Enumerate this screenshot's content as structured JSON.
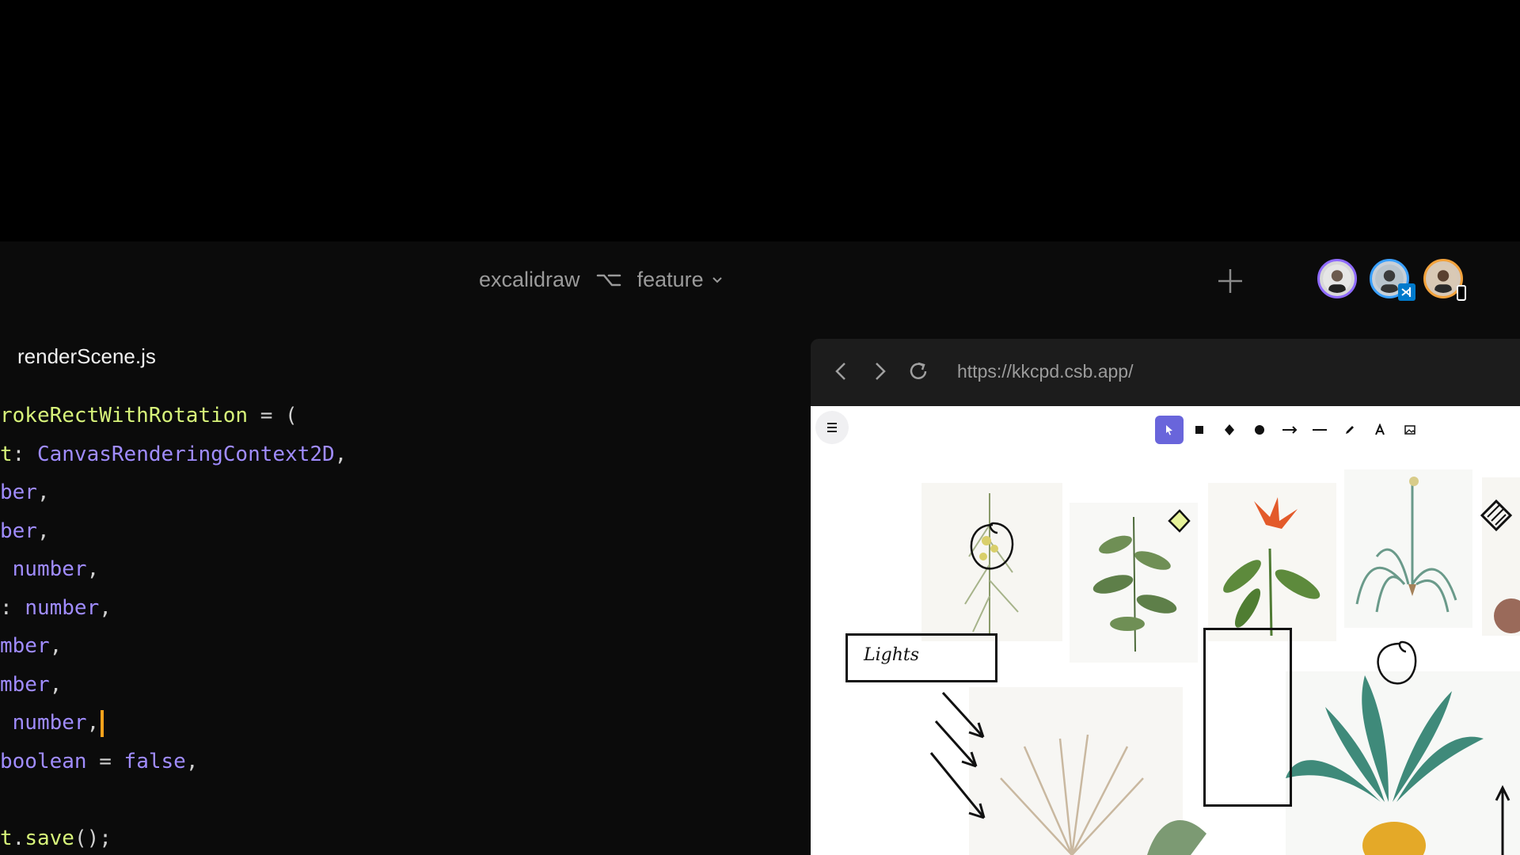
{
  "header": {
    "repo_name": "excalidraw",
    "branch_name": "feature"
  },
  "editor": {
    "file_tab": "renderScene.js",
    "lines": [
      [
        {
          "c": "fn",
          "t": "rokeRectWithRotation"
        },
        {
          "c": "punc",
          "t": " = ("
        }
      ],
      [
        {
          "c": "fn",
          "t": "t"
        },
        {
          "c": "punc",
          "t": ": "
        },
        {
          "c": "type",
          "t": "CanvasRenderingContext2D"
        },
        {
          "c": "punc",
          "t": ","
        }
      ],
      [
        {
          "c": "type",
          "t": "ber"
        },
        {
          "c": "punc",
          "t": ","
        }
      ],
      [
        {
          "c": "type",
          "t": "ber"
        },
        {
          "c": "punc",
          "t": ","
        }
      ],
      [
        {
          "c": "punc",
          "t": " "
        },
        {
          "c": "type",
          "t": "number"
        },
        {
          "c": "punc",
          "t": ","
        }
      ],
      [
        {
          "c": "punc",
          "t": ": "
        },
        {
          "c": "type",
          "t": "number"
        },
        {
          "c": "punc",
          "t": ","
        }
      ],
      [
        {
          "c": "type",
          "t": "mber"
        },
        {
          "c": "punc",
          "t": ","
        }
      ],
      [
        {
          "c": "type",
          "t": "mber"
        },
        {
          "c": "punc",
          "t": ","
        }
      ],
      [
        {
          "c": "punc",
          "t": " "
        },
        {
          "c": "type",
          "t": "number"
        },
        {
          "c": "punc",
          "t": ","
        },
        {
          "c": "cursor",
          "t": ""
        }
      ],
      [
        {
          "c": "type",
          "t": "boolean"
        },
        {
          "c": "punc",
          "t": " = "
        },
        {
          "c": "kw",
          "t": "false"
        },
        {
          "c": "punc",
          "t": ","
        }
      ],
      [],
      [
        {
          "c": "fn",
          "t": "t"
        },
        {
          "c": "punc",
          "t": "."
        },
        {
          "c": "fn",
          "t": "save"
        },
        {
          "c": "punc",
          "t": "();"
        }
      ]
    ]
  },
  "browser": {
    "url": "https://kkcpd.csb.app/"
  },
  "canvas": {
    "text_label": "Lights",
    "tools": [
      "selection-icon",
      "rectangle-icon",
      "diamond-icon",
      "ellipse-icon",
      "arrow-icon",
      "line-icon",
      "pencil-icon",
      "text-icon",
      "image-icon"
    ],
    "active_tool": "selection-icon",
    "accent_color": "#6965db"
  },
  "colors": {
    "function": "#d7f37a",
    "type": "#a08cff",
    "cursor": "#f7a21b"
  }
}
